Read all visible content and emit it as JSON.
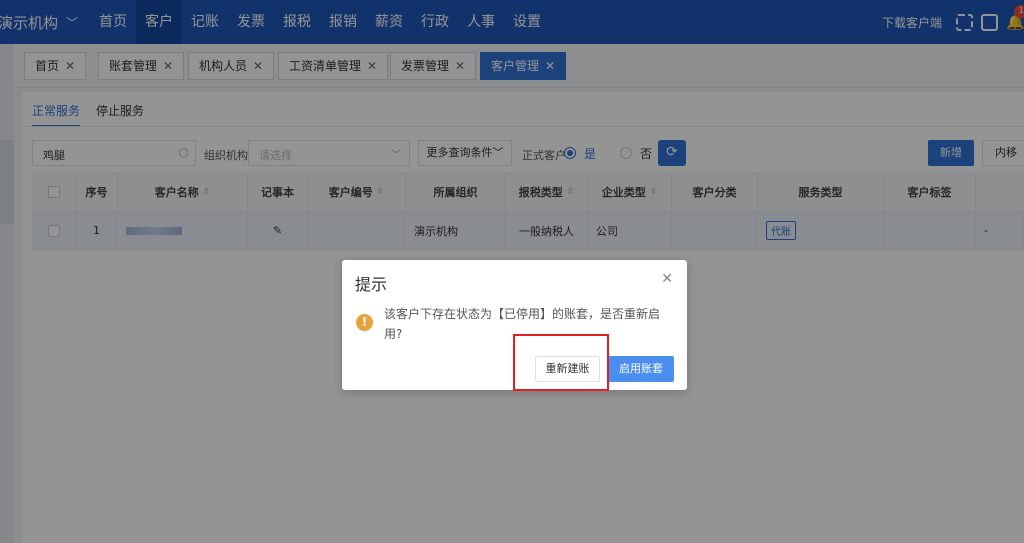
{
  "topbar": {
    "org_name": "演示机构",
    "nav": [
      "首页",
      "客户",
      "记账",
      "发票",
      "报税",
      "报销",
      "薪资",
      "行政",
      "人事",
      "设置"
    ],
    "active_nav": "客户",
    "download_label": "下载客户端",
    "notification_count": "1"
  },
  "tabs": [
    {
      "label": "首页"
    },
    {
      "label": "账套管理"
    },
    {
      "label": "机构人员"
    },
    {
      "label": "工资清单管理"
    },
    {
      "label": "发票管理"
    },
    {
      "label": "客户管理"
    }
  ],
  "tab_close": "✕",
  "service_tabs": [
    "正常服务",
    "停止服务"
  ],
  "filters": {
    "search_value": "鸡腿",
    "org_label": "组织机构",
    "org_placeholder": "请选择",
    "more_label": "更多查询条件",
    "formal_label": "正式客户",
    "yes": "是",
    "no": "否",
    "new_label": "新增",
    "move_label": "内移"
  },
  "table": {
    "headers": [
      "序号",
      "客户名称",
      "记事本",
      "客户编号",
      "所属组织",
      "报税类型",
      "企业类型",
      "客户分类",
      "服务类型",
      "客户标签"
    ],
    "row": {
      "index": "1",
      "org": "演示机构",
      "tax_type": "一般纳税人",
      "company_type": "公司",
      "service_tag": "代账",
      "extra": "-"
    }
  },
  "dialog": {
    "title": "提示",
    "message": "该客户下存在状态为【已停用】的账套，是否重新启用?",
    "rebuild_label": "重新建账",
    "enable_label": "启用账套"
  }
}
